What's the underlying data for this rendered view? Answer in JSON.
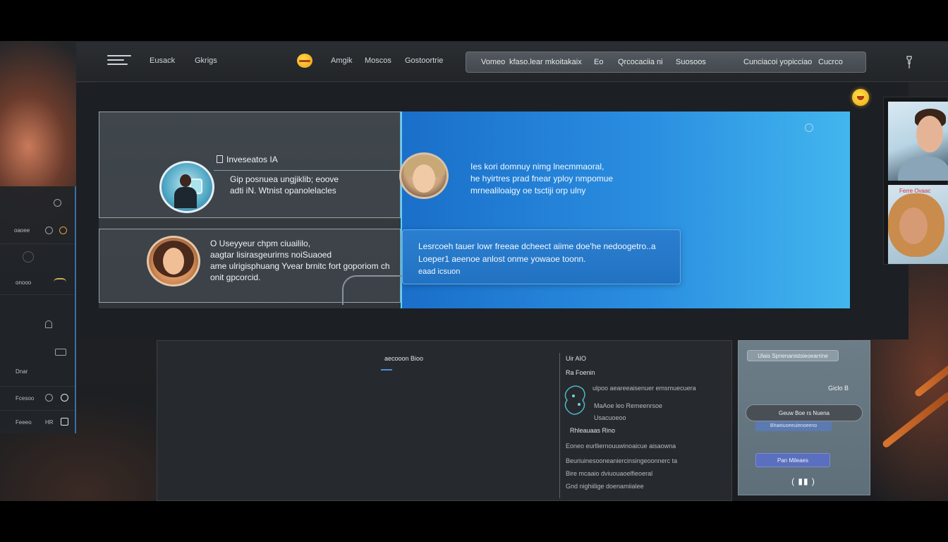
{
  "nav": {
    "links": [
      "Eusack",
      "Gkrigs",
      "Amgik",
      "Moscos",
      "Gostoortrie"
    ],
    "search_segments": [
      "Vomeo",
      "kfaso.lear mkoitakaix",
      "Eo",
      "Qrcocaciia ni",
      "Suosoos",
      "Cunciacoi yopicciao",
      "Cucrco"
    ]
  },
  "hero": {
    "card1_title": "Inveseatos IA",
    "card1_text": [
      "Gip posnuea ungjiklib; eoove",
      "adti iN. Wtnist opanolelacles"
    ],
    "card2_text": [
      "O  Useyyeur chpm ciuaililo,",
      "aagtar lisirasgeurirns noiSuaoed",
      "ame ulrigisphuang Yvear brnitc fort goporiom ch",
      "onit gpcorcid."
    ],
    "blue_text": [
      "Ies  kori domnuy nimg lnecmmaoral,",
      "he hyirtres prad fnear yploy nmpomue",
      "mrnealiloaigy oe tsctiji orp ulny"
    ],
    "blue_card_text": [
      "Lesrcoeh tauer lowr freeae dcheect aiime doe'he nedoogetro..a",
      "Loeper1 aeenoe anlost onme yowaoe toonn.",
      "eaad icsuon"
    ]
  },
  "photo_strip": {
    "label": "Ferre Ovaac"
  },
  "sidebar": {
    "labels": [
      "oaoee",
      "onooo",
      "Dnar",
      "Fcesoo",
      "Feeeo"
    ],
    "counts": [
      "HR"
    ]
  },
  "bottom": {
    "head_left": "aecooon Bioo",
    "head_right": "Uir AIO",
    "sub_right": "Ra  Foenin",
    "lines": [
      "ulpoo aeareeaisenuer emsmuecuera",
      "MaAoe leo Remeenrsoe",
      "Usacuoeoo",
      "Rhleauaas   Rino",
      "Eoneo eurlliernouuwinoaicue aisaowna",
      "Beuriuinesooneaniercinsingeoonnerc ta",
      "Bire mcaaio dviuouaoelfieoeral",
      "Gnd nighiilige doenamiialee"
    ]
  },
  "side_card": {
    "top_label": "Ulais   Spnenanistsieoearrine",
    "count": "Giclo B",
    "oval_label": "Geuw Boe rs Nuena",
    "strip_label": "Bhaeiuoeeuienoeeno",
    "button_label": "Pan Mileaes",
    "controls": "( ▮▮ )"
  },
  "colors": {
    "accent": "#2a8ee0",
    "notif": "#f0a611",
    "sidebar_accent": "#3a6fa3"
  }
}
